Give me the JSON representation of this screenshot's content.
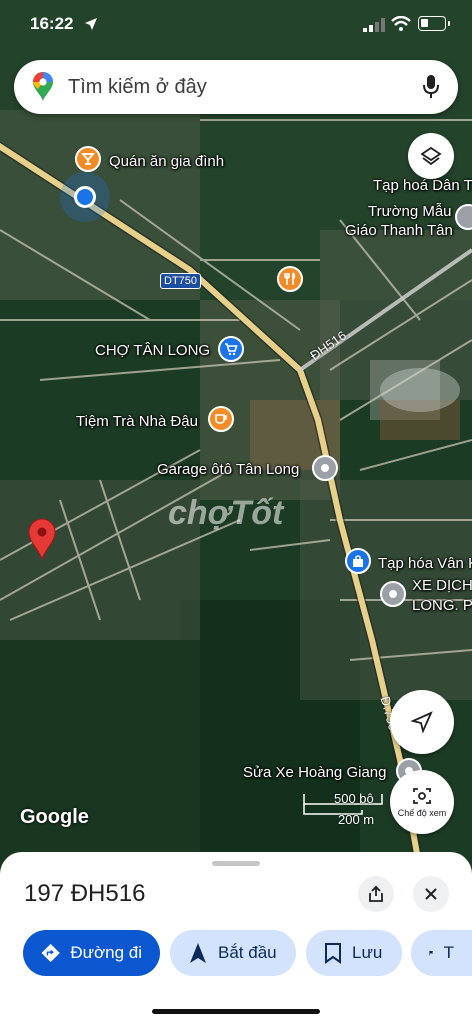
{
  "status_bar": {
    "time": "16:22"
  },
  "search": {
    "placeholder": "Tìm kiếm ở đây"
  },
  "map": {
    "places": [
      {
        "label": "Quán ăn gia đình",
        "icon": "bar-icon"
      },
      {
        "label": "Tạp hoá Dân T",
        "icon": null
      },
      {
        "label": "Trường Mẫu",
        "icon": null
      },
      {
        "label": "Giáo Thanh Tân",
        "icon": "school-icon"
      },
      {
        "label": "CHỢ TÂN LONG",
        "icon": "shopping-cart-icon"
      },
      {
        "label": "Tiệm Trà Nhà Đậu",
        "icon": "cafe-icon"
      },
      {
        "label": "Garage ôtô Tân Long",
        "icon": "place-icon"
      },
      {
        "label": "Tạp hóa Vân K",
        "icon": "shopping-bag-icon"
      },
      {
        "label": "XE DỊCH",
        "icon": "place-icon"
      },
      {
        "label": "LONG. P",
        "icon": null
      },
      {
        "label": "Sửa Xe Hoàng Giang",
        "icon": "place-icon"
      }
    ],
    "road_labels": [
      "DT750",
      "ĐH516",
      "Đ.750"
    ],
    "watermark": "chợTốt",
    "attribution": "Google",
    "scale": {
      "imperial": "500 bộ",
      "metric": "200 m"
    },
    "view_mode_label": "Chế độ xem",
    "colors": {
      "road": "#e7d089",
      "pin": "#e53935",
      "poi_orange": "#f28c28",
      "poi_blue": "#1a73e8",
      "poi_gray": "#9aa0a6"
    }
  },
  "place_sheet": {
    "title": "197 ĐH516",
    "actions": [
      {
        "label": "Đường đi",
        "icon": "directions-icon"
      },
      {
        "label": "Bắt đầu",
        "icon": "navigation-icon"
      },
      {
        "label": "Lưu",
        "icon": "bookmark-icon"
      },
      {
        "label": "T",
        "icon": "flag-icon"
      }
    ]
  }
}
